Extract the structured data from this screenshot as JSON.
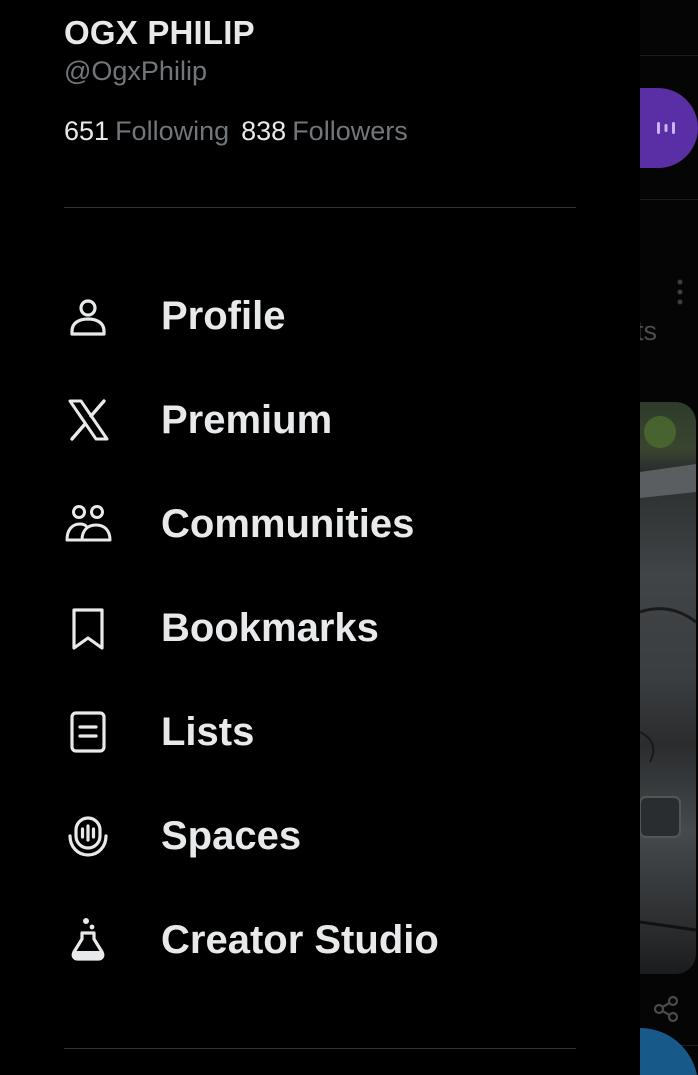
{
  "profile": {
    "display_name": "OGX PHILIP",
    "handle": "@OgxPhilip",
    "following_count": "651",
    "following_label": "Following",
    "followers_count": "838",
    "followers_label": "Followers"
  },
  "menu": {
    "items": [
      {
        "label": "Profile",
        "icon": "person-icon"
      },
      {
        "label": "Premium",
        "icon": "x-logo-icon"
      },
      {
        "label": "Communities",
        "icon": "communities-icon"
      },
      {
        "label": "Bookmarks",
        "icon": "bookmark-icon"
      },
      {
        "label": "Lists",
        "icon": "list-icon"
      },
      {
        "label": "Spaces",
        "icon": "spaces-icon"
      },
      {
        "label": "Creator Studio",
        "icon": "flask-icon"
      }
    ]
  },
  "background": {
    "partial_text": "ts"
  },
  "colors": {
    "background": "#000000",
    "primary_text": "#e7e9ea",
    "secondary_text": "#71767b",
    "divider": "#2f3336",
    "spaces_accent": "#5a2fa6",
    "fab_accent": "#175a8a"
  }
}
